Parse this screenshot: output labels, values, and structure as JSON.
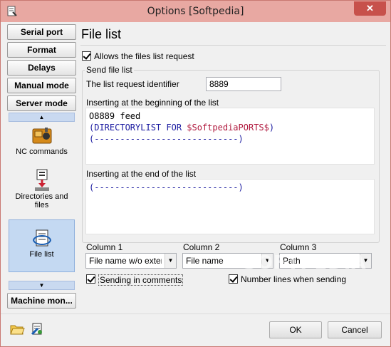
{
  "window": {
    "title": "Options [Softpedia]",
    "close_glyph": "✕"
  },
  "sidebar": {
    "buttons_top": [
      "Serial port",
      "Format",
      "Delays",
      "Manual mode",
      "Server mode"
    ],
    "modules": [
      {
        "label": "NC commands",
        "icon": "nc-commands-icon"
      },
      {
        "label": "Directories and files",
        "icon": "directories-icon"
      },
      {
        "label": "File list",
        "icon": "file-list-icon",
        "selected": true
      }
    ],
    "scroll_up": "▲",
    "scroll_down": "▼",
    "buttons_bottom": [
      "Machine mon..."
    ]
  },
  "panel": {
    "title": "File list",
    "allow_request_label": "Allows the files list request",
    "allow_request_checked": true,
    "send_group_label": "Send file list",
    "identifier_label": "The list request identifier",
    "identifier_value": "8889",
    "begin_label": "Inserting at the beginning of the list",
    "begin_lines": [
      [
        {
          "t": "O8889 feed",
          "c": "black"
        }
      ],
      [
        {
          "t": "(DIRECTORYLIST FOR ",
          "c": "blue"
        },
        {
          "t": "$SoftpediaPORTS$",
          "c": "red"
        },
        {
          "t": ")",
          "c": "blue"
        }
      ],
      [
        {
          "t": "(----------------------------)",
          "c": "blue"
        }
      ]
    ],
    "end_label": "Inserting at the end of the list",
    "end_lines": [
      [
        {
          "t": "(----------------------------)",
          "c": "blue"
        }
      ]
    ],
    "columns": [
      {
        "label": "Column 1",
        "value": "File name w/o extension"
      },
      {
        "label": "Column 2",
        "value": "File name"
      },
      {
        "label": "Column 3",
        "value": "Path"
      }
    ],
    "sending_comments_label": "Sending in comments",
    "sending_comments_checked": true,
    "number_lines_label": "Number lines when sending",
    "number_lines_checked": true
  },
  "footer": {
    "ok_label": "OK",
    "cancel_label": "Cancel"
  },
  "watermark": "SOFTPEDIA",
  "colors": {
    "titlebar": "#e8a8a2",
    "selected": "#c4d9f2",
    "code_blue": "#1a1aa0",
    "code_red": "#b0183d"
  }
}
